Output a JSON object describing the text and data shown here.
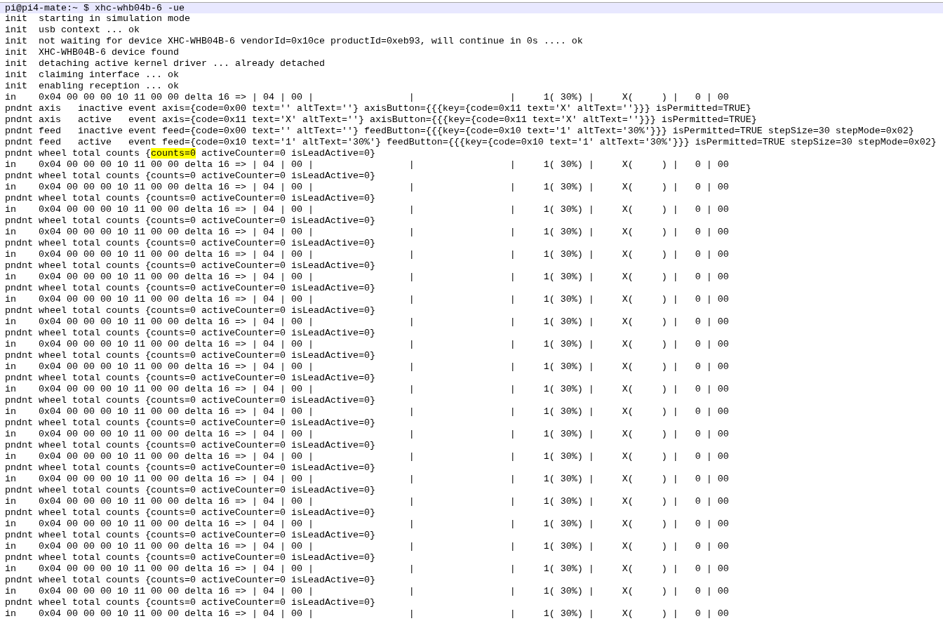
{
  "lines": [
    {
      "kind": "prompt",
      "text": "pi@pi4-mate:~ $ xhc-whb04b-6 -ue"
    },
    {
      "kind": "output",
      "text": "init  starting in simulation mode"
    },
    {
      "kind": "output",
      "text": "init  usb context ... ok"
    },
    {
      "kind": "output",
      "text": "init  not waiting for device XHC-WHB04B-6 vendorId=0x10ce productId=0xeb93, will continue in 0s .... ok"
    },
    {
      "kind": "output",
      "text": "init  XHC-WHB04B-6 device found"
    },
    {
      "kind": "output",
      "text": "init  detaching active kernel driver ... already detached"
    },
    {
      "kind": "output",
      "text": "init  claiming interface ... ok"
    },
    {
      "kind": "output",
      "text": "init  enabling reception ... ok"
    },
    {
      "kind": "output",
      "text": "in    0x04 00 00 00 10 11 00 00 delta 16 => | 04 | 00 |                 |                 |     1( 30%) |     X(     ) |   0 | 00"
    },
    {
      "kind": "output",
      "text": "pndnt axis   inactive event axis={code=0x00 text='' altText=''} axisButton={{{key={code=0x11 text='X' altText=''}}} isPermitted=TRUE}"
    },
    {
      "kind": "output",
      "text": "pndnt axis   active   event axis={code=0x11 text='X' altText=''} axisButton={{{key={code=0x11 text='X' altText=''}}} isPermitted=TRUE}"
    },
    {
      "kind": "output",
      "text": "pndnt feed   inactive event feed={code=0x00 text='' altText=''} feedButton={{{key={code=0x10 text='1' altText='30%'}}} isPermitted=TRUE stepSize=30 stepMode=0x02}"
    },
    {
      "kind": "output",
      "text": "pndnt feed   active   event feed={code=0x10 text='1' altText='30%'} feedButton={{{key={code=0x10 text='1' altText='30%'}}} isPermitted=TRUE stepSize=30 stepMode=0x02}"
    },
    {
      "kind": "output",
      "parts": [
        {
          "text": "pndnt wheel total counts {",
          "highlighted": false
        },
        {
          "text": "counts=0",
          "highlighted": true
        },
        {
          "text": " activeCounter=0 isLeadActive=0}",
          "highlighted": false
        }
      ]
    },
    {
      "kind": "output",
      "text": "in    0x04 00 00 00 10 11 00 00 delta 16 => | 04 | 00 |                 |                 |     1( 30%) |     X(     ) |   0 | 00"
    },
    {
      "kind": "output",
      "text": "pndnt wheel total counts {counts=0 activeCounter=0 isLeadActive=0}"
    },
    {
      "kind": "output",
      "text": "in    0x04 00 00 00 10 11 00 00 delta 16 => | 04 | 00 |                 |                 |     1( 30%) |     X(     ) |   0 | 00"
    },
    {
      "kind": "output",
      "text": "pndnt wheel total counts {counts=0 activeCounter=0 isLeadActive=0}"
    },
    {
      "kind": "output",
      "text": "in    0x04 00 00 00 10 11 00 00 delta 16 => | 04 | 00 |                 |                 |     1( 30%) |     X(     ) |   0 | 00"
    },
    {
      "kind": "output",
      "text": "pndnt wheel total counts {counts=0 activeCounter=0 isLeadActive=0}"
    },
    {
      "kind": "output",
      "text": "in    0x04 00 00 00 10 11 00 00 delta 16 => | 04 | 00 |                 |                 |     1( 30%) |     X(     ) |   0 | 00"
    },
    {
      "kind": "output",
      "text": "pndnt wheel total counts {counts=0 activeCounter=0 isLeadActive=0}"
    },
    {
      "kind": "output",
      "text": "in    0x04 00 00 00 10 11 00 00 delta 16 => | 04 | 00 |                 |                 |     1( 30%) |     X(     ) |   0 | 00"
    },
    {
      "kind": "output",
      "text": "pndnt wheel total counts {counts=0 activeCounter=0 isLeadActive=0}"
    },
    {
      "kind": "output",
      "text": "in    0x04 00 00 00 10 11 00 00 delta 16 => | 04 | 00 |                 |                 |     1( 30%) |     X(     ) |   0 | 00"
    },
    {
      "kind": "output",
      "text": "pndnt wheel total counts {counts=0 activeCounter=0 isLeadActive=0}"
    },
    {
      "kind": "output",
      "text": "in    0x04 00 00 00 10 11 00 00 delta 16 => | 04 | 00 |                 |                 |     1( 30%) |     X(     ) |   0 | 00"
    },
    {
      "kind": "output",
      "text": "pndnt wheel total counts {counts=0 activeCounter=0 isLeadActive=0}"
    },
    {
      "kind": "output",
      "text": "in    0x04 00 00 00 10 11 00 00 delta 16 => | 04 | 00 |                 |                 |     1( 30%) |     X(     ) |   0 | 00"
    },
    {
      "kind": "output",
      "text": "pndnt wheel total counts {counts=0 activeCounter=0 isLeadActive=0}"
    },
    {
      "kind": "output",
      "text": "in    0x04 00 00 00 10 11 00 00 delta 16 => | 04 | 00 |                 |                 |     1( 30%) |     X(     ) |   0 | 00"
    },
    {
      "kind": "output",
      "text": "pndnt wheel total counts {counts=0 activeCounter=0 isLeadActive=0}"
    },
    {
      "kind": "output",
      "text": "in    0x04 00 00 00 10 11 00 00 delta 16 => | 04 | 00 |                 |                 |     1( 30%) |     X(     ) |   0 | 00"
    },
    {
      "kind": "output",
      "text": "pndnt wheel total counts {counts=0 activeCounter=0 isLeadActive=0}"
    },
    {
      "kind": "output",
      "text": "in    0x04 00 00 00 10 11 00 00 delta 16 => | 04 | 00 |                 |                 |     1( 30%) |     X(     ) |   0 | 00"
    },
    {
      "kind": "output",
      "text": "pndnt wheel total counts {counts=0 activeCounter=0 isLeadActive=0}"
    },
    {
      "kind": "output",
      "text": "in    0x04 00 00 00 10 11 00 00 delta 16 => | 04 | 00 |                 |                 |     1( 30%) |     X(     ) |   0 | 00"
    },
    {
      "kind": "output",
      "text": "pndnt wheel total counts {counts=0 activeCounter=0 isLeadActive=0}"
    },
    {
      "kind": "output",
      "text": "in    0x04 00 00 00 10 11 00 00 delta 16 => | 04 | 00 |                 |                 |     1( 30%) |     X(     ) |   0 | 00"
    },
    {
      "kind": "output",
      "text": "pndnt wheel total counts {counts=0 activeCounter=0 isLeadActive=0}"
    },
    {
      "kind": "output",
      "text": "in    0x04 00 00 00 10 11 00 00 delta 16 => | 04 | 00 |                 |                 |     1( 30%) |     X(     ) |   0 | 00"
    },
    {
      "kind": "output",
      "text": "pndnt wheel total counts {counts=0 activeCounter=0 isLeadActive=0}"
    },
    {
      "kind": "output",
      "text": "in    0x04 00 00 00 10 11 00 00 delta 16 => | 04 | 00 |                 |                 |     1( 30%) |     X(     ) |   0 | 00"
    },
    {
      "kind": "output",
      "text": "pndnt wheel total counts {counts=0 activeCounter=0 isLeadActive=0}"
    },
    {
      "kind": "output",
      "text": "in    0x04 00 00 00 10 11 00 00 delta 16 => | 04 | 00 |                 |                 |     1( 30%) |     X(     ) |   0 | 00"
    },
    {
      "kind": "output",
      "text": "pndnt wheel total counts {counts=0 activeCounter=0 isLeadActive=0}"
    },
    {
      "kind": "output",
      "text": "in    0x04 00 00 00 10 11 00 00 delta 16 => | 04 | 00 |                 |                 |     1( 30%) |     X(     ) |   0 | 00"
    },
    {
      "kind": "output",
      "text": "pndnt wheel total counts {counts=0 activeCounter=0 isLeadActive=0}"
    },
    {
      "kind": "output",
      "text": "in    0x04 00 00 00 10 11 00 00 delta 16 => | 04 | 00 |                 |                 |     1( 30%) |     X(     ) |   0 | 00"
    },
    {
      "kind": "output",
      "text": "pndnt wheel total counts {counts=0 activeCounter=0 isLeadActive=0}"
    },
    {
      "kind": "output",
      "text": "in    0x04 00 00 00 10 11 00 00 delta 16 => | 04 | 00 |                 |                 |     1( 30%) |     X(     ) |   0 | 00"
    },
    {
      "kind": "output",
      "text": "pndnt wheel total counts {counts=0 activeCounter=0 isLeadActive=0}"
    },
    {
      "kind": "output",
      "text": "in    0x04 00 00 00 10 11 00 00 delta 16 => | 04 | 00 |                 |                 |     1( 30%) |     X(     ) |   0 | 00"
    },
    {
      "kind": "output",
      "text": "pndnt wheel total counts {counts=0 activeCounter=0 isLeadActive=0}"
    },
    {
      "kind": "output",
      "text": "in    0x04 00 00 00 10 11 00 00 delta 16 => | 04 | 00 |                 |                 |     1( 30%) |     X(     ) |   0 | 00"
    }
  ]
}
